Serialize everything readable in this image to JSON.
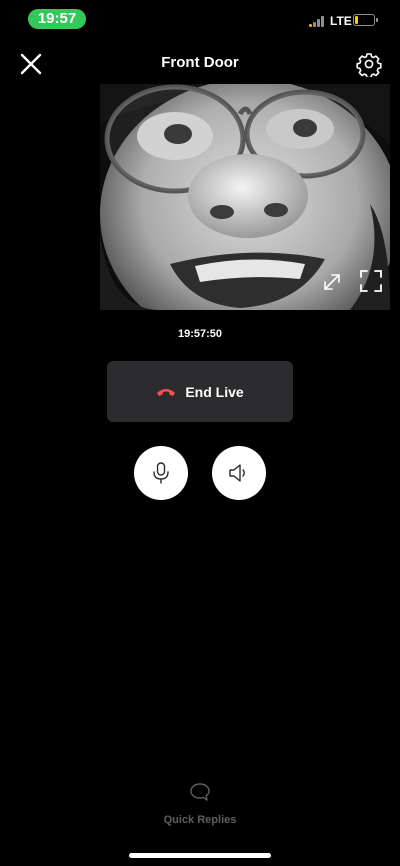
{
  "status_bar": {
    "time": "19:57",
    "network": "LTE",
    "battery": "17",
    "battery_fraction": 0.17,
    "time_pill_color": "#34c759",
    "battery_color": "#ffcc00"
  },
  "header": {
    "title": "Front Door",
    "close_icon": "close-icon",
    "settings_icon": "gear-icon"
  },
  "video": {
    "expand_icon": "expand-arrows-icon",
    "fullscreen_icon": "fullscreen-icon"
  },
  "timestamp": "19:57:50",
  "end_live": {
    "label": "End Live",
    "icon": "hang-up-phone-icon",
    "icon_color": "#ff4d4d",
    "background": "#2c2c2e"
  },
  "controls": {
    "mic_icon": "microphone-icon",
    "speaker_icon": "speaker-icon"
  },
  "quick_replies": {
    "label": "Quick Replies",
    "icon": "chat-bubble-icon"
  }
}
